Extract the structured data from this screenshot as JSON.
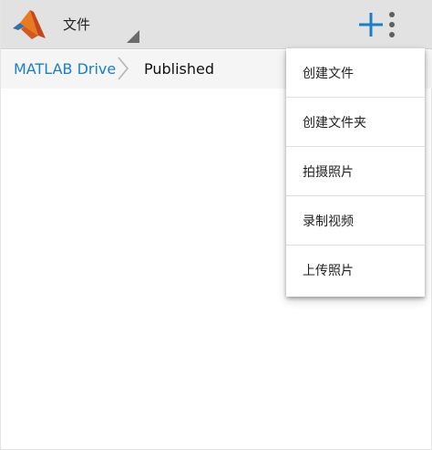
{
  "header": {
    "title": "文件",
    "logo_icon": "matlab-logo",
    "add_icon": "plus-icon",
    "overflow_icon": "more-vertical-icon",
    "accent_color": "#1a7fc4"
  },
  "breadcrumb": {
    "root": "MATLAB Drive",
    "separator_icon": "chevron-right-icon",
    "current": "Published"
  },
  "menu": {
    "items": [
      {
        "label": "创建文件"
      },
      {
        "label": "创建文件夹"
      },
      {
        "label": "拍摄照片"
      },
      {
        "label": "录制视频"
      },
      {
        "label": "上传照片"
      }
    ]
  }
}
